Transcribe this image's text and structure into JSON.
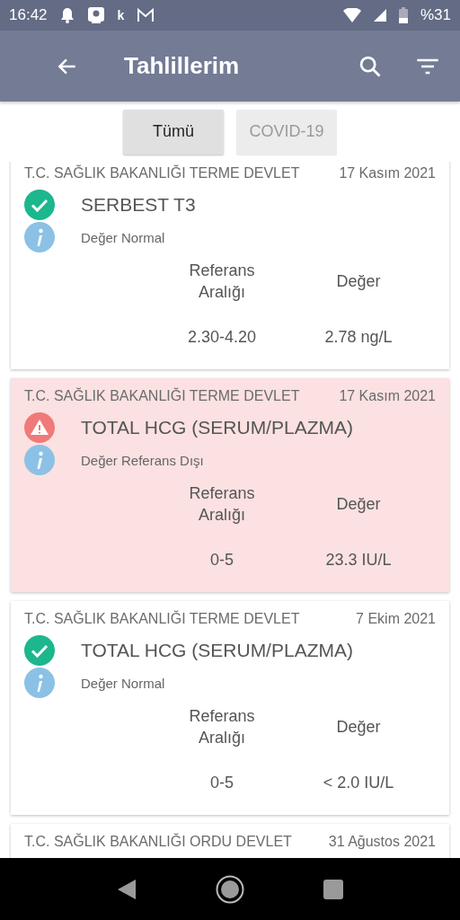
{
  "status_bar": {
    "time": "16:42",
    "notification_letter": "k",
    "battery": "%31"
  },
  "app_bar": {
    "title": "Tahlillerim"
  },
  "tabs": [
    {
      "label": "Tümü",
      "selected": true
    },
    {
      "label": "COVID-19",
      "selected": false
    }
  ],
  "results": [
    {
      "institution": "T.C. SAĞLIK BAKANLIĞI TERME DEVLET",
      "date": "17 Kasım 2021",
      "kind": "normal",
      "test": "SERBEST T3",
      "note": "Değer Normal",
      "ref_header": "Referans Aralığı",
      "value_header": "Değer",
      "ref_range": "2.30-4.20",
      "value": "2.78 ng/L"
    },
    {
      "institution": "T.C. SAĞLIK BAKANLIĞI TERME DEVLET",
      "date": "17 Kasım 2021",
      "kind": "abnormal",
      "test": "TOTAL HCG (SERUM/PLAZMA)",
      "note": "Değer Referans Dışı",
      "ref_header": "Referans Aralığı",
      "value_header": "Değer",
      "ref_range": "0-5",
      "value": "23.3 IU/L"
    },
    {
      "institution": "T.C. SAĞLIK BAKANLIĞI TERME DEVLET",
      "date": "7 Ekim 2021",
      "kind": "normal",
      "test": "TOTAL HCG (SERUM/PLAZMA)",
      "note": "Değer Normal",
      "ref_header": "Referans Aralığı",
      "value_header": "Değer",
      "ref_range": "0-5",
      "value": "< 2.0 IU/L"
    },
    {
      "institution": "T.C. SAĞLIK BAKANLIĞI ORDU DEVLET",
      "date": "31 Ağustos 2021"
    }
  ]
}
